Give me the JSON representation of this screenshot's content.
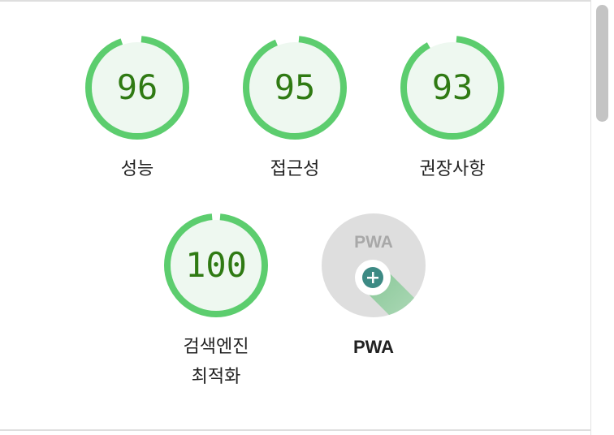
{
  "gauges": [
    {
      "label": "성능",
      "score": "96",
      "percent": 96
    },
    {
      "label": "접근성",
      "score": "95",
      "percent": 95
    },
    {
      "label": "권장사항",
      "score": "93",
      "percent": 93
    },
    {
      "label_line1": "검색엔진",
      "label_line2": "최적화",
      "score": "100",
      "percent": 100
    }
  ],
  "pwa": {
    "label": "PWA",
    "badge_text": "PWA",
    "icon": "plus-icon"
  },
  "colors": {
    "pass_ring": "#5ccd6e",
    "pass_fill": "#eef8f0",
    "pass_text": "#2f7a13",
    "pwa_bg": "#dedede",
    "pwa_plus": "#3d8a84"
  }
}
